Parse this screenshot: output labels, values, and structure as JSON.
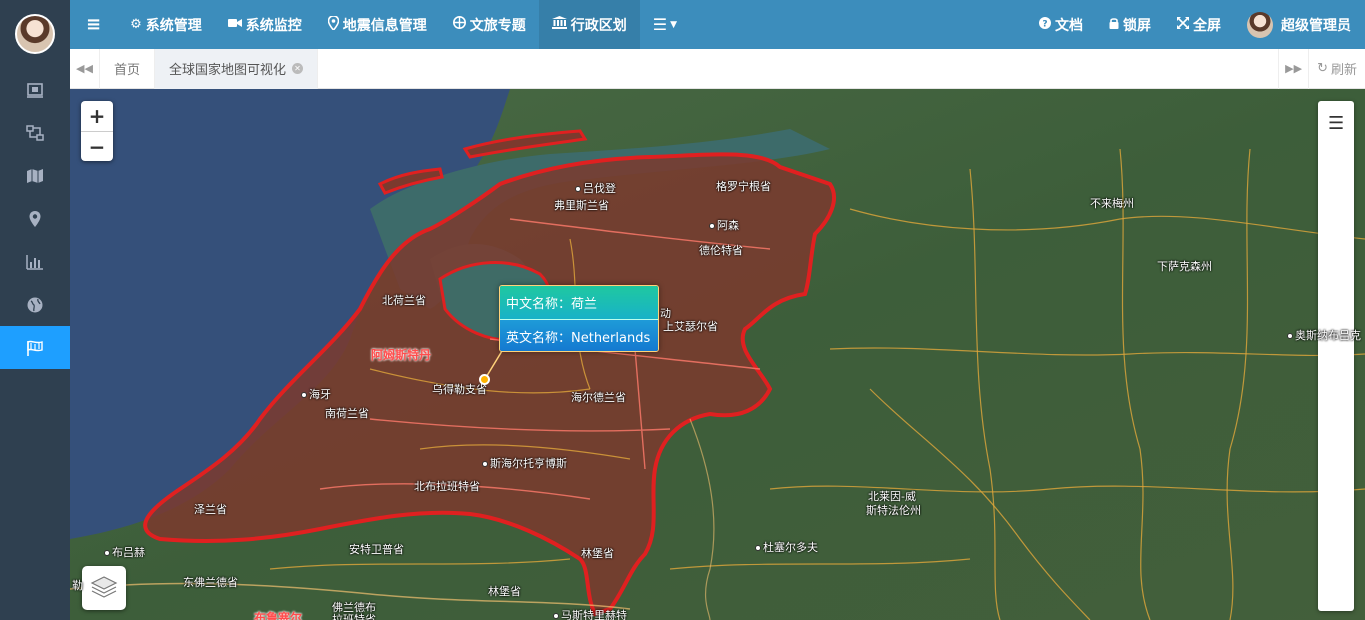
{
  "sidebar": {
    "items": [
      {
        "icon": "screen-icon"
      },
      {
        "icon": "network-icon"
      },
      {
        "icon": "map-icon"
      },
      {
        "icon": "location-pin-icon"
      },
      {
        "icon": "bar-chart-icon"
      },
      {
        "icon": "globe-icon"
      },
      {
        "icon": "flag-icon",
        "active": true
      }
    ]
  },
  "topbar": {
    "menu_toggle": "≡",
    "items": [
      {
        "label": "系统管理",
        "icon": "gear-icon"
      },
      {
        "label": "系统监控",
        "icon": "video-camera-icon"
      },
      {
        "label": "地震信息管理",
        "icon": "map-pin-icon"
      },
      {
        "label": "文旅专题",
        "icon": "globe-icon"
      },
      {
        "label": "行政区划",
        "icon": "bank-icon"
      }
    ],
    "right": {
      "docs": "文档",
      "lock": "锁屏",
      "fullscreen": "全屏",
      "user": "超级管理员"
    }
  },
  "tabs": {
    "home": "首页",
    "active": "全球国家地图可视化",
    "refresh": "刷新"
  },
  "map": {
    "popup": {
      "cn_label": "中文名称：荷兰",
      "en_label": "英文名称：Netherlands"
    },
    "labels": {
      "l1": "吕伐登",
      "l2": "格罗宁根省",
      "l3": "弗里斯兰省",
      "l4": "阿森",
      "l5": "德伦特省",
      "l6": "不来梅州",
      "l7": "下萨克森州",
      "l8": "北荷兰省",
      "l9": "阿姆斯特丹",
      "l10": "上艾瑟尔省",
      "l11": "奥斯纳布吕克",
      "l12": "海牙",
      "l13": "乌得勒支省",
      "l14": "南荷兰省",
      "l15": "海尔德兰省",
      "l16": "斯海尔托亨博斯",
      "l17": "北布拉班特省",
      "l18": "泽兰省",
      "l19": "北莱因-威",
      "l20": "斯特法伦州",
      "l21": "布吕赫",
      "l22": "安特卫普省",
      "l23": "林堡省",
      "l24": "杜塞尔多夫",
      "l25": "东佛兰德省",
      "l26": "林堡省",
      "l27": "佛兰德布",
      "l28": "拉班特省",
      "l29": "马斯特里赫特",
      "l30": "布鲁塞尔",
      "l31": "勒",
      "l32": "动"
    }
  }
}
